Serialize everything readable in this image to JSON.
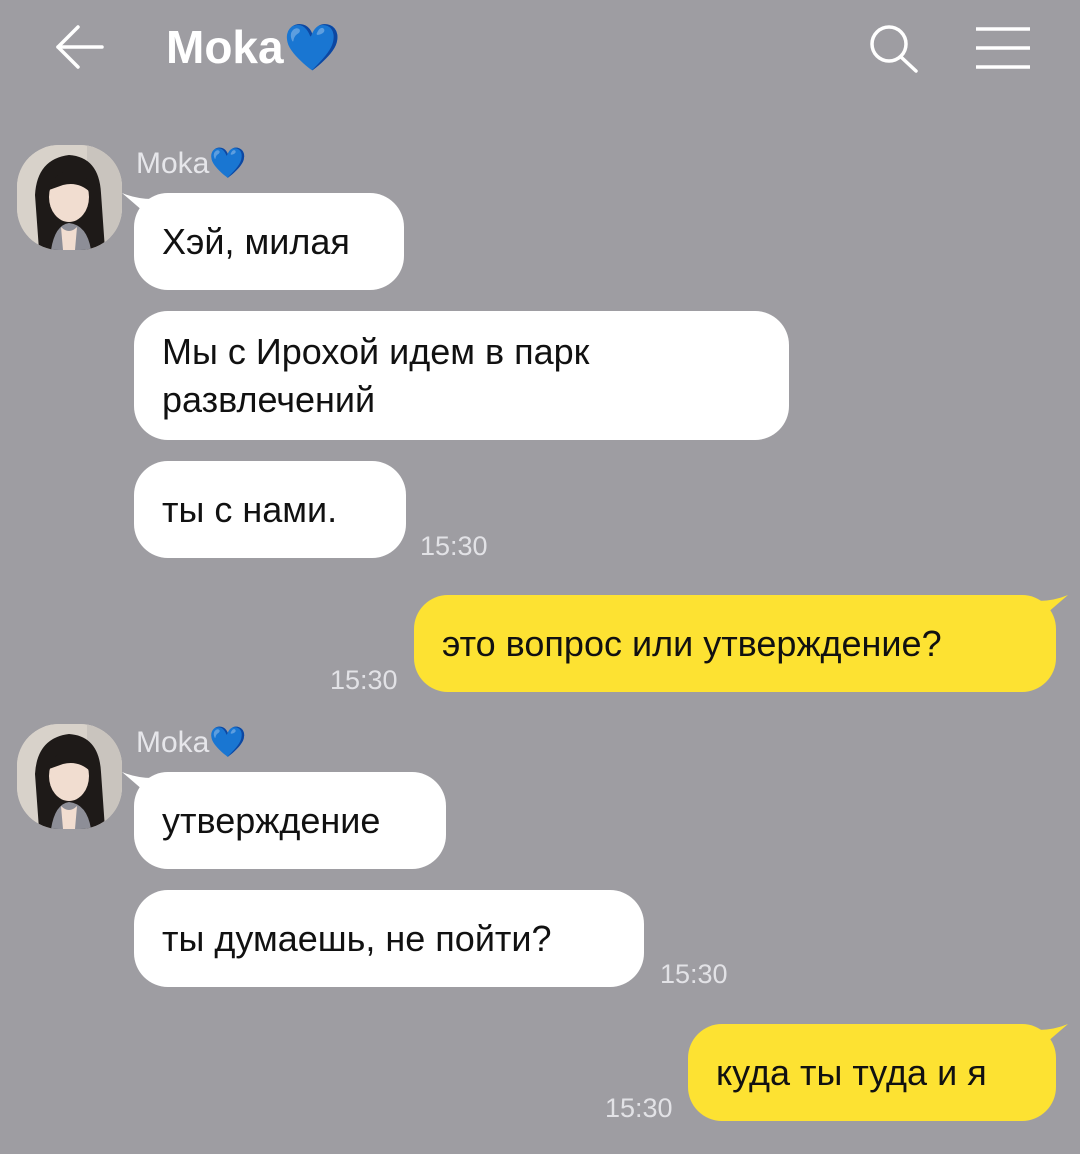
{
  "header": {
    "back_icon": "arrow-left-icon",
    "title": "Moka💙",
    "search_icon": "search-icon",
    "menu_icon": "hamburger-menu-icon"
  },
  "colors": {
    "background": "#9e9da2",
    "incoming_bubble": "#ffffff",
    "outgoing_bubble": "#fde232"
  },
  "messages": [
    {
      "sender": "Moka💙",
      "direction": "incoming",
      "text": "Хэй, милая"
    },
    {
      "direction": "incoming",
      "text_lines": [
        "Мы с Ирохой идем в парк",
        "развлечений"
      ]
    },
    {
      "direction": "incoming",
      "text": "ты с нами.",
      "time": "15:30"
    },
    {
      "direction": "outgoing",
      "text": "это вопрос или утверждение?",
      "time": "15:30"
    },
    {
      "sender": "Moka💙",
      "direction": "incoming",
      "text": "утверждение"
    },
    {
      "direction": "incoming",
      "text": "ты думаешь, не пойти?",
      "time": "15:30"
    },
    {
      "direction": "outgoing",
      "text": "куда ты туда и я",
      "time": "15:30"
    }
  ]
}
